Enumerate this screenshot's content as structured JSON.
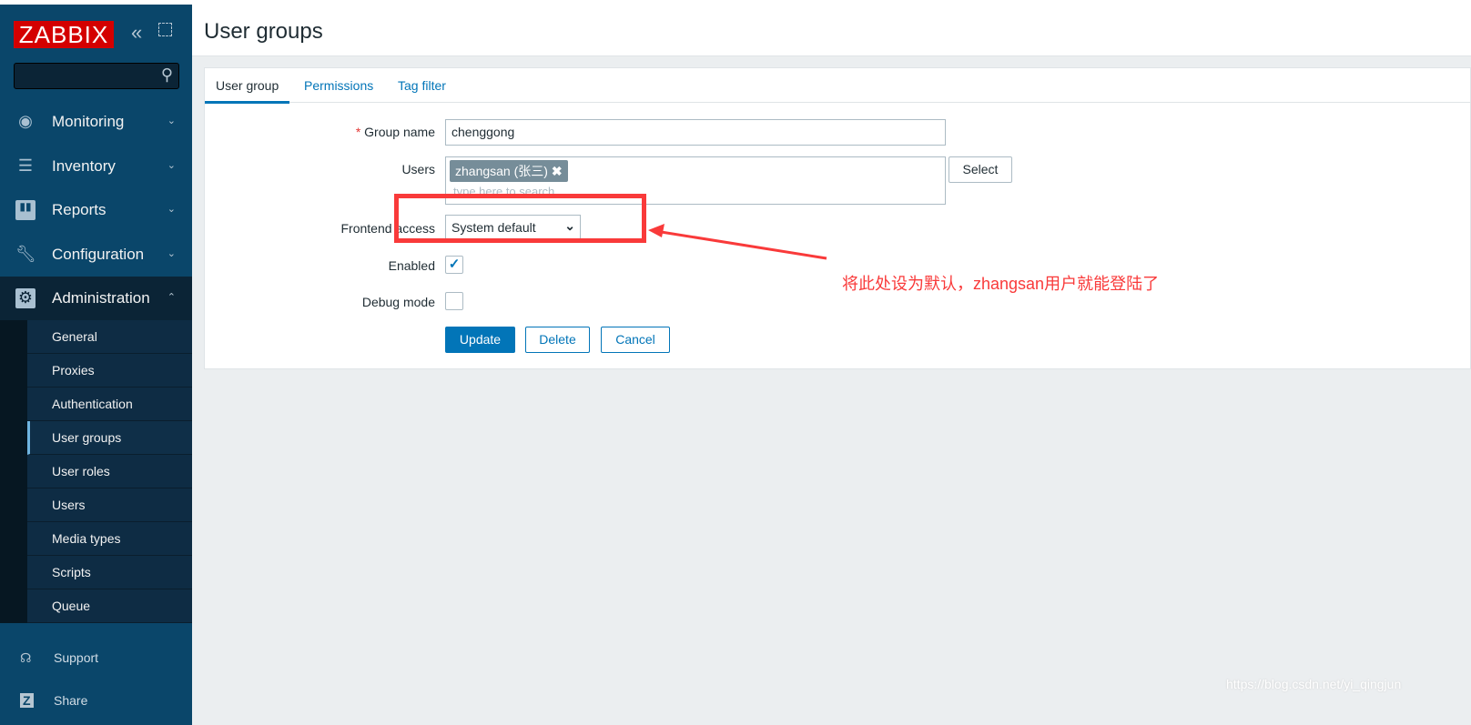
{
  "sidebar": {
    "logo": "ZABBIX",
    "search_placeholder": "",
    "menu": [
      {
        "label": "Monitoring",
        "icon": "eye-icon"
      },
      {
        "label": "Inventory",
        "icon": "list-icon"
      },
      {
        "label": "Reports",
        "icon": "bar-chart-icon"
      },
      {
        "label": "Configuration",
        "icon": "wrench-icon"
      },
      {
        "label": "Administration",
        "icon": "gear-icon"
      }
    ],
    "submenu": [
      "General",
      "Proxies",
      "Authentication",
      "User groups",
      "User roles",
      "Users",
      "Media types",
      "Scripts",
      "Queue"
    ],
    "support": "Support",
    "share": "Share"
  },
  "header": {
    "title": "User groups"
  },
  "tabs": [
    "User group",
    "Permissions",
    "Tag filter"
  ],
  "form": {
    "group_name_label": "Group name",
    "group_name_value": "chenggong",
    "users_label": "Users",
    "user_tag": "zhangsan (张三)",
    "users_placeholder": "type here to search",
    "select_label": "Select",
    "frontend_label": "Frontend access",
    "frontend_value": "System default",
    "enabled_label": "Enabled",
    "enabled": true,
    "debug_label": "Debug mode",
    "debug": false,
    "update": "Update",
    "delete": "Delete",
    "cancel": "Cancel"
  },
  "annotation": {
    "text": "将此处设为默认，zhangsan用户就能登陆了",
    "color": "#f93a3a"
  },
  "watermark": "https://blog.csdn.net/yi_qingjun"
}
